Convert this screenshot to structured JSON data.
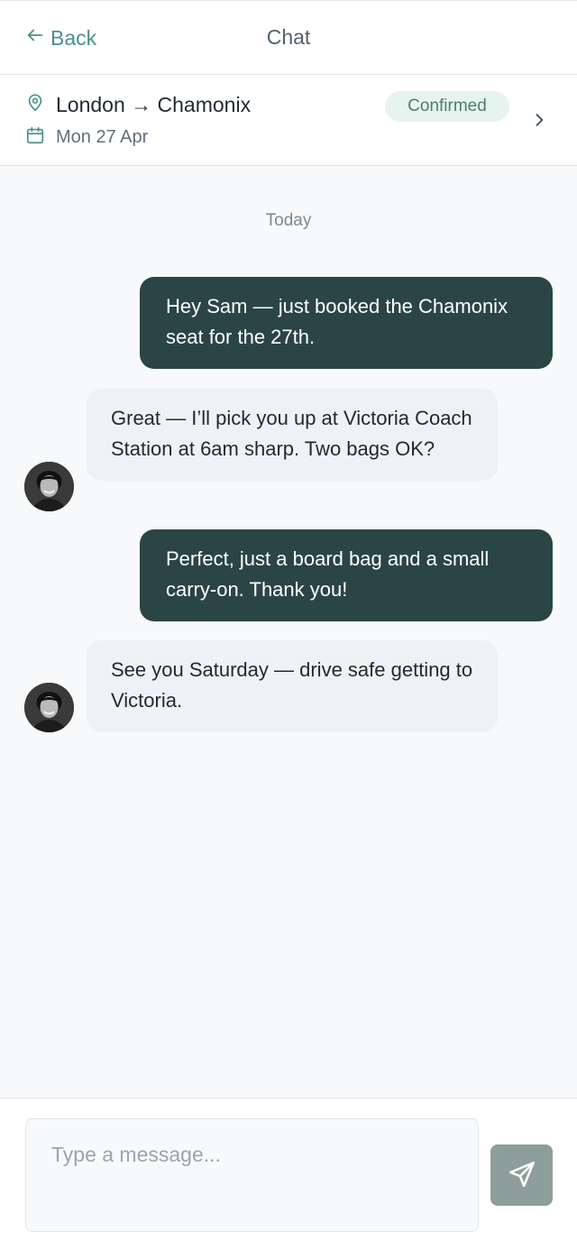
{
  "header": {
    "back_label": "Back",
    "title": "Chat"
  },
  "trip": {
    "route": "London → Chamonix",
    "date": "Mon 27 Apr",
    "status": "Confirmed"
  },
  "conversation": {
    "day_separator": "Today",
    "messages": [
      {
        "direction": "out",
        "text": "Hey Sam — just booked the Chamonix seat for the 27th."
      },
      {
        "direction": "in",
        "text": "Great — I’ll pick you up at Victoria Coach Station at 6am sharp. Two bags OK?"
      },
      {
        "direction": "out",
        "text": "Perfect, just a board bag and a small carry-on. Thank you!"
      },
      {
        "direction": "in",
        "text": "See you Saturday — drive safe getting to Victoria."
      }
    ]
  },
  "composer": {
    "placeholder": "Type a message...",
    "value": ""
  },
  "colors": {
    "accent": "#4a8f8d",
    "outgoing_bubble": "#2b4544",
    "incoming_bubble": "#eff2f4",
    "badge_bg": "#e7f3ee",
    "send_button": "#8e9e9b"
  },
  "icons": {
    "back": "arrow-left-icon",
    "location": "map-pin-icon",
    "date": "calendar-icon",
    "open_trip": "chevron-right-icon",
    "send": "send-icon"
  }
}
